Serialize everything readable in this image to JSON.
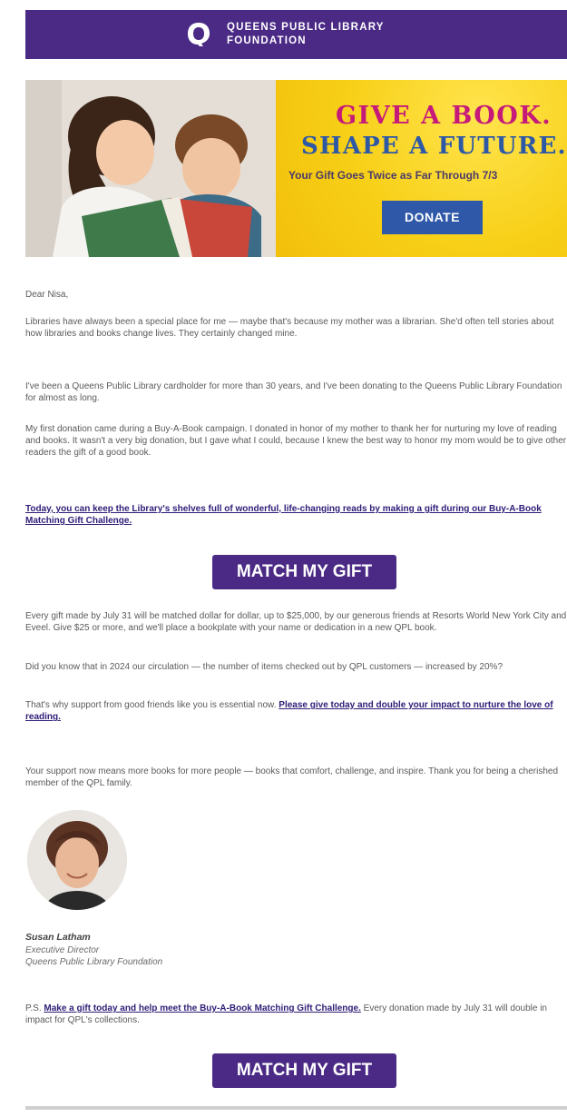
{
  "header": {
    "logo_icon": "queens-q-logo",
    "org_line1": "QUEENS PUBLIC LIBRARY",
    "org_line2": "FOUNDATION",
    "bg_color": "#4b2a86"
  },
  "hero": {
    "headline1": "GIVE A BOOK.",
    "headline2": "SHAPE A FUTURE.",
    "subline": "Your Gift Goes Twice as Far Through 7/3",
    "donate_label": "DONATE",
    "photo": "children-reading-photo"
  },
  "letter": {
    "greeting": "Dear Nisa,",
    "p1": "Libraries have always been a special place for me — maybe that's because my mother was a librarian. She'd often tell stories about how libraries and books change lives. They certainly changed mine.",
    "p2": "I've been a Queens Public Library cardholder for more than 30 years, and I've been donating to the Queens Public Library Foundation for almost as long.",
    "p3": "My first donation came during a Buy-A-Book campaign. I donated in honor of my mother to thank her for nurturing my love of reading and books. It wasn't a very big donation, but I gave what I could, because I knew the best way to honor my mom would be to give other readers the gift of a good book.",
    "link1": "Today, you can keep the Library's shelves full of wonderful, life-changing reads by making a gift during our Buy-A-Book Matching Gift Challenge.",
    "cta1": "MATCH MY GIFT",
    "p4": "Every gift made by July 31 will be matched dollar for dollar, up to $25,000, by our generous friends at Resorts World New York City and Eveel. Give $25 or more, and we'll place a bookplate with your name or dedication in a new QPL book.",
    "p5": "Did you know that in 2024 our circulation — the number of items checked out by QPL customers — increased by 20%?",
    "p6_text": "That's why support from good friends like you is essential now.",
    "p6_link": "Please give today and double your impact to nurture the love of reading.",
    "p7": "Your support now means more books for more people — books that comfort, challenge, and inspire. Thank you for being a cherished member of the QPL family."
  },
  "signature": {
    "avatar": "susan-latham-portrait",
    "name": "Susan Latham",
    "title": "Executive Director",
    "org": "Queens Public Library Foundation"
  },
  "ps": {
    "prefix": "P.S.",
    "link": "Make a gift today and help meet the Buy-A-Book Matching Gift Challenge.",
    "text": "Every donation made by July 31 will double in impact for QPL's collections.",
    "cta2": "MATCH MY GIFT"
  },
  "colors": {
    "purple": "#4b2a86",
    "blue": "#2f59a8",
    "magenta": "#c51a7a",
    "yellow": "#f7cf16"
  }
}
